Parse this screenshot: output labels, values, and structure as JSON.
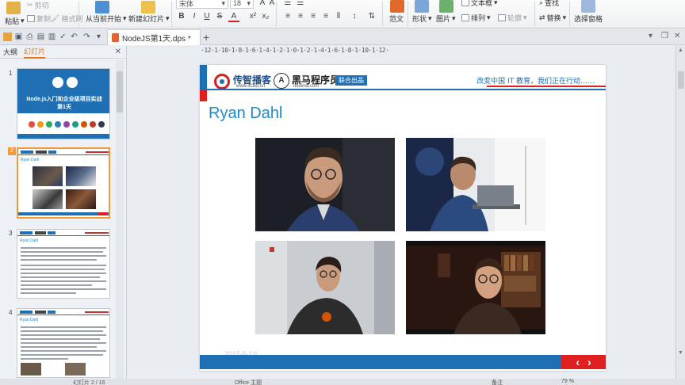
{
  "ribbon": {
    "paste": "粘贴",
    "cut": "剪切",
    "copy": "复制",
    "format_painter": "格式刷",
    "from_current": "从当前开始",
    "new_slide": "新建幻灯片",
    "font_name": "宋体",
    "font_size": "18",
    "template": "范文",
    "shape": "形状",
    "picture": "图片",
    "textbox": "文本框",
    "arrange": "排列",
    "outline": "轮廓",
    "find": "查找",
    "replace": "替换",
    "select_pane": "选择窗格"
  },
  "tabs": {
    "document": "NodeJS第1天.dps *"
  },
  "left_panel": {
    "tab_outline": "大纲",
    "tab_slides": "幻灯片",
    "slide_numbers": [
      "1",
      "2",
      "3",
      "4"
    ],
    "slide1_title_line1": "Node.js入门和企业级项目实战",
    "slide1_title_line2": "第1天",
    "thumb_title": "Ryan Dahl"
  },
  "ruler": "·12·1·10·1·8·1·6·1·4·1·2·1·0·1·2·1·4·1·6·1·8·1·10·1·12·",
  "slide": {
    "brand1_name": "传智播客",
    "brand1_url": "www.itcast.cn",
    "brand2_logo": "A",
    "brand2_name": "黑马程序员",
    "brand2_url": "itheima.com",
    "coop": "联合出品",
    "slogan": "改变中国 IT 教育，我们正在行动……",
    "title": "Ryan Dahl",
    "date": "2015-6-19",
    "prev": "‹",
    "next": "›"
  },
  "status": {
    "slide_info": "幻灯片 2 / 16",
    "theme": "Office 主题",
    "notes": "备注",
    "zoom": "79 %"
  },
  "colors": {
    "brand_blue": "#1f6fb5",
    "brand_red": "#e02020",
    "title_blue": "#1f8ad0",
    "selection_orange": "#f19a3e"
  }
}
